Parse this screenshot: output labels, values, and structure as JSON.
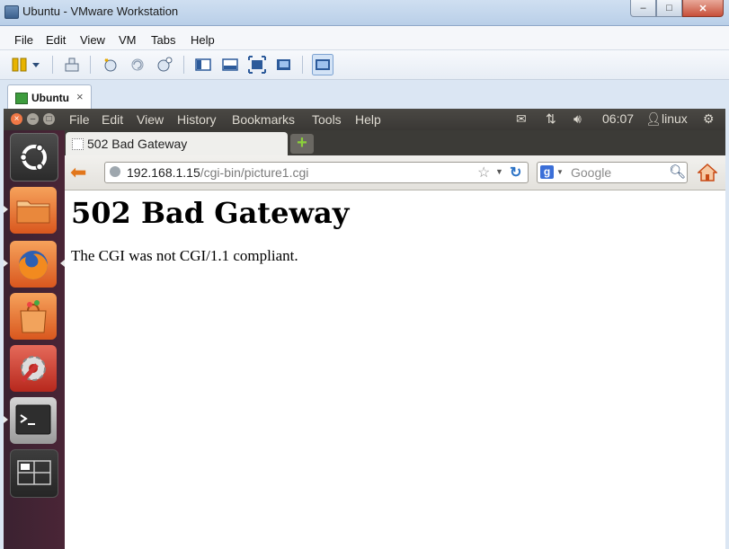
{
  "vmware": {
    "title": "Ubuntu - VMware Workstation",
    "window_controls": {
      "minimize": "–",
      "maximize": "□",
      "close": "✕"
    },
    "menu": [
      "File",
      "Edit",
      "View",
      "VM",
      "Tabs",
      "Help"
    ],
    "tab": {
      "label": "Ubuntu",
      "close": "×"
    }
  },
  "ubuntu_panel": {
    "menu": [
      "File",
      "Edit",
      "View",
      "History",
      "Bookmarks",
      "Tools",
      "Help"
    ],
    "clock": "06:07",
    "user": "linux"
  },
  "firefox": {
    "tab_title": "502 Bad Gateway",
    "new_tab": "+",
    "url_host": "192.168.1.15",
    "url_path": "/cgi-bin/picture1.cgi",
    "search_placeholder": "Google"
  },
  "page": {
    "heading": "502 Bad Gateway",
    "message": "The CGI was not CGI/1.1 compliant."
  }
}
